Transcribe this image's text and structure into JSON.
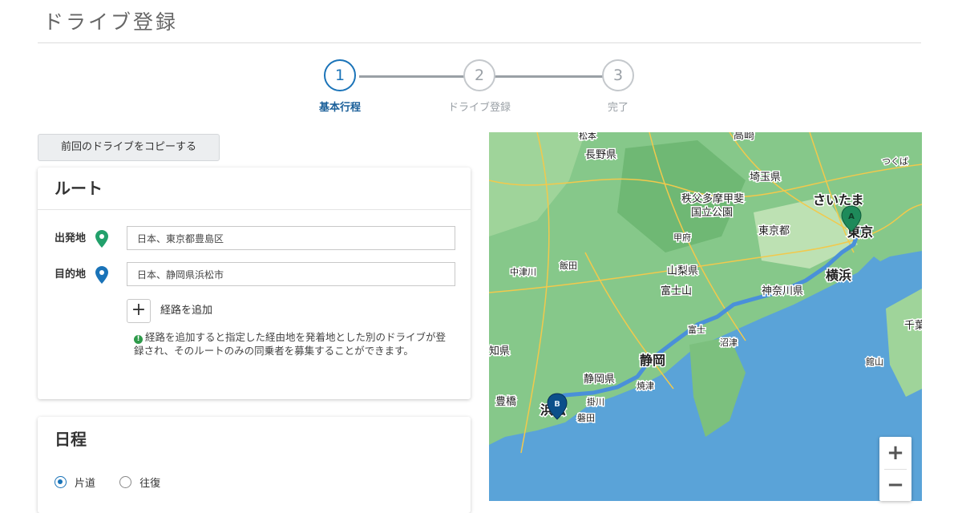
{
  "page": {
    "title": "ドライブ登録"
  },
  "stepper": {
    "steps": [
      {
        "number": "1",
        "label": "基本行程",
        "state": "active"
      },
      {
        "number": "2",
        "label": "ドライブ登録",
        "state": "inactive"
      },
      {
        "number": "3",
        "label": "完了",
        "state": "inactive"
      }
    ]
  },
  "copy_button": {
    "label": "前回のドライブをコピーする"
  },
  "route": {
    "title": "ルート",
    "origin": {
      "label": "出発地",
      "value": "日本、東京都豊島区",
      "pin_color": "#22a06b"
    },
    "destination": {
      "label": "目的地",
      "value": "日本、静岡県浜松市",
      "pin_color": "#1a73b8"
    },
    "add_waypoint": {
      "icon": "+",
      "label": "経路を追加"
    },
    "note": "経路を追加すると指定した経由地を発着地とした別のドライブが登録され、そのルートのみの同乗者を募集することができます。"
  },
  "schedule": {
    "title": "日程",
    "options": [
      {
        "label": "片道",
        "checked": true
      },
      {
        "label": "往復",
        "checked": false
      }
    ]
  },
  "map": {
    "places": [
      {
        "name": "松本"
      },
      {
        "name": "高崎"
      },
      {
        "name": "長野県"
      },
      {
        "name": "埼玉県"
      },
      {
        "name": "つくば"
      },
      {
        "name": "さいたま"
      },
      {
        "name": "秩父多摩甲斐"
      },
      {
        "name": "国立公園"
      },
      {
        "name": "東京都"
      },
      {
        "name": "東京"
      },
      {
        "name": "甲府"
      },
      {
        "name": "中津川"
      },
      {
        "name": "飯田"
      },
      {
        "name": "山梨県"
      },
      {
        "name": "横浜"
      },
      {
        "name": "富士山"
      },
      {
        "name": "神奈川県"
      },
      {
        "name": "富士"
      },
      {
        "name": "沼津"
      },
      {
        "name": "千葉"
      },
      {
        "name": "知県"
      },
      {
        "name": "静岡"
      },
      {
        "name": "館山"
      },
      {
        "name": "静岡県"
      },
      {
        "name": "豊橋"
      },
      {
        "name": "焼津"
      },
      {
        "name": "浜松"
      },
      {
        "name": "掛川"
      },
      {
        "name": "磐田"
      }
    ],
    "markers": [
      {
        "label": "A"
      },
      {
        "label": "B"
      }
    ],
    "zoom_in": "+",
    "zoom_out": "−",
    "colors": {
      "land": "#86c88a",
      "sea": "#5aa3d8",
      "route": "#4a90d9",
      "road": "#f2c94c",
      "marker_a": "#1e8a5a",
      "marker_b": "#0b4f8a"
    }
  }
}
